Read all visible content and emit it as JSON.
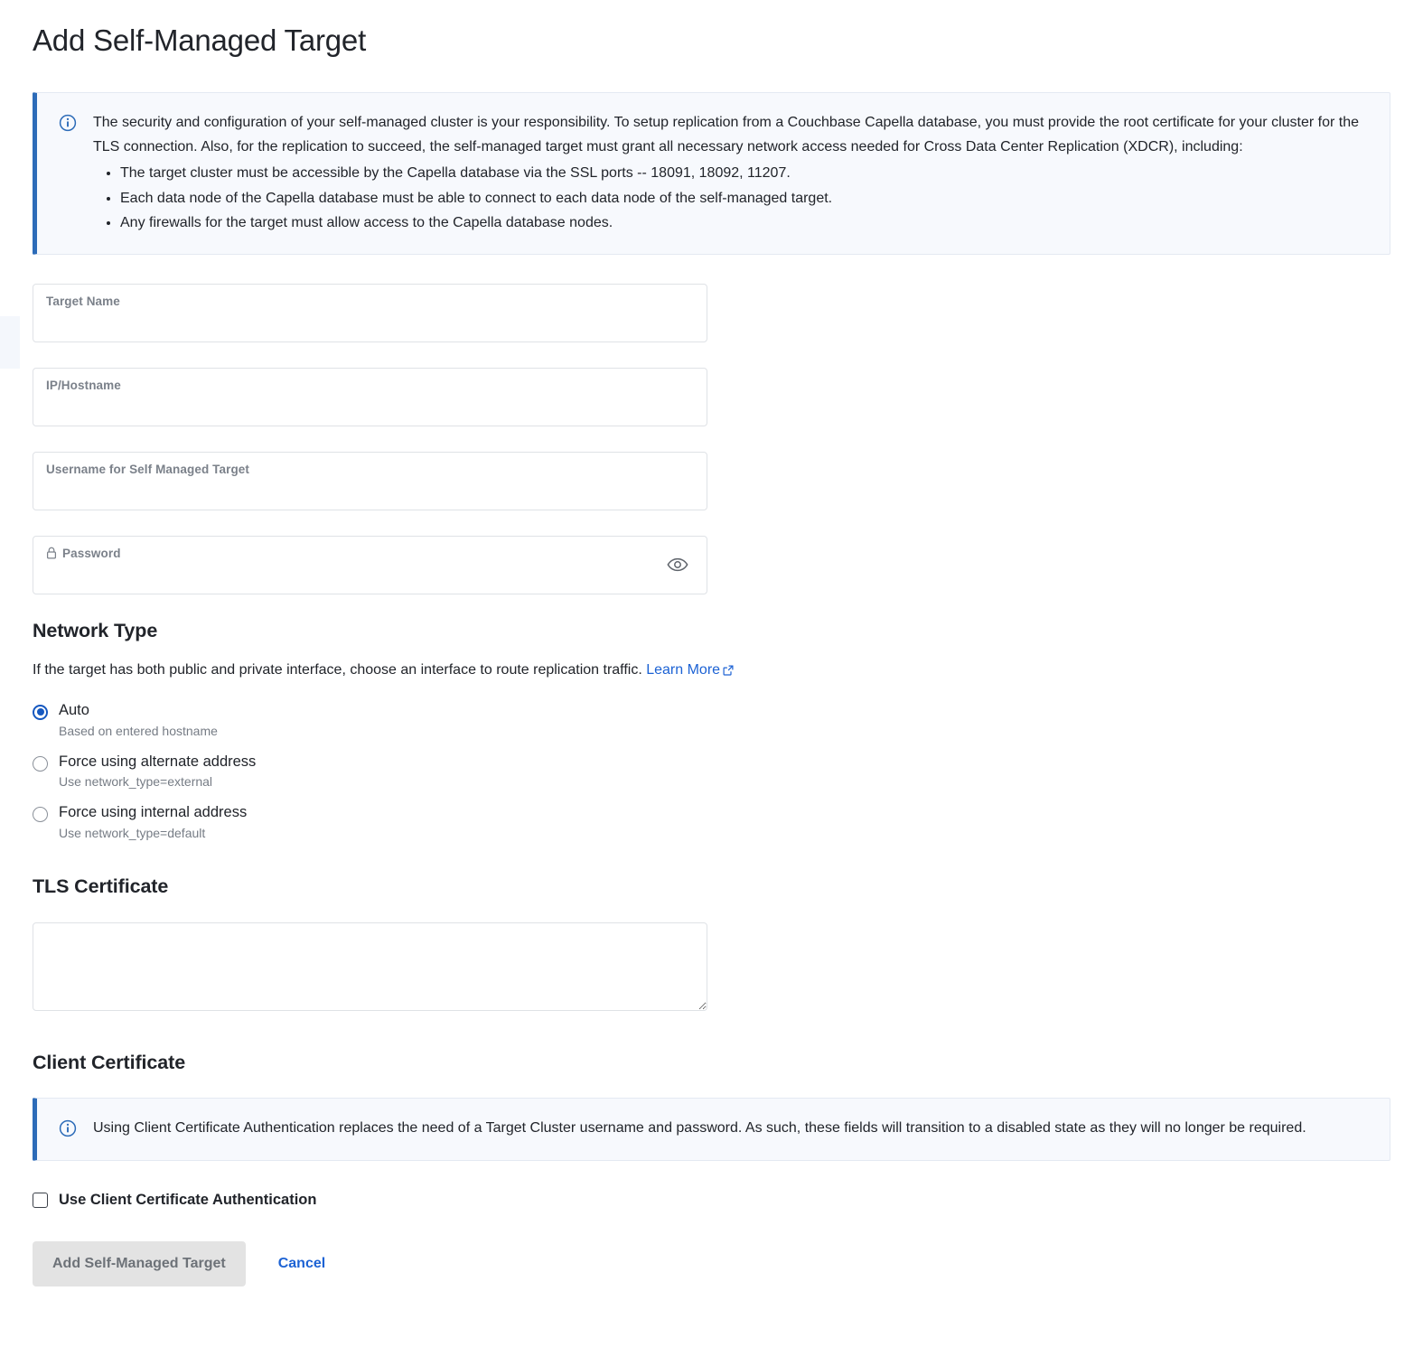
{
  "page": {
    "title": "Add Self-Managed Target"
  },
  "info_banner": {
    "icon": "info-circle-icon",
    "paragraph": "The security and configuration of your self-managed cluster is your responsibility. To setup replication from a Couchbase Capella database, you must provide the root certificate for your cluster for the TLS connection. Also, for the replication to succeed, the self-managed target must grant all necessary network access needed for Cross Data Center Replication (XDCR), including:",
    "bullets": [
      "The target cluster must be accessible by the Capella database via the SSL ports -- 18091, 18092, 11207.",
      "Each data node of the Capella database must be able to connect to each data node of the self-managed target.",
      "Any firewalls for the target must allow access to the Capella database nodes."
    ],
    "accent_color": "#2c6bb8",
    "background_color": "#f7f9fd"
  },
  "form": {
    "target_name": {
      "label": "Target Name",
      "value": "",
      "placeholder": ""
    },
    "ip_hostname": {
      "label": "IP/Hostname",
      "value": "",
      "placeholder": ""
    },
    "username": {
      "label": "Username for Self Managed Target",
      "value": "",
      "placeholder": ""
    },
    "password": {
      "label": "Password",
      "value": "",
      "placeholder": "",
      "lock_icon": "lock-icon",
      "reveal_icon": "eye-icon"
    }
  },
  "network_type": {
    "heading": "Network Type",
    "description": "If the target has both public and private interface, choose an interface to route replication traffic.",
    "learn_more": "Learn More",
    "selected": "auto",
    "options": [
      {
        "id": "auto",
        "label": "Auto",
        "sub": "Based on entered hostname",
        "checked": true
      },
      {
        "id": "alternate",
        "label": "Force using alternate address",
        "sub": "Use network_type=external",
        "checked": false
      },
      {
        "id": "internal",
        "label": "Force using internal address",
        "sub": "Use network_type=default",
        "checked": false
      }
    ]
  },
  "tls_certificate": {
    "heading": "TLS Certificate",
    "value": "",
    "placeholder": ""
  },
  "client_certificate": {
    "heading": "Client Certificate",
    "banner": {
      "icon": "info-circle-icon",
      "text": "Using Client Certificate Authentication replaces the need of a Target Cluster username and password. As such, these fields will transition to a disabled state as they will no longer be required."
    },
    "checkbox": {
      "label": "Use Client Certificate Authentication",
      "checked": false
    }
  },
  "actions": {
    "submit_label": "Add Self-Managed Target",
    "submit_disabled": true,
    "cancel_label": "Cancel",
    "link_color": "#1c62d4"
  }
}
